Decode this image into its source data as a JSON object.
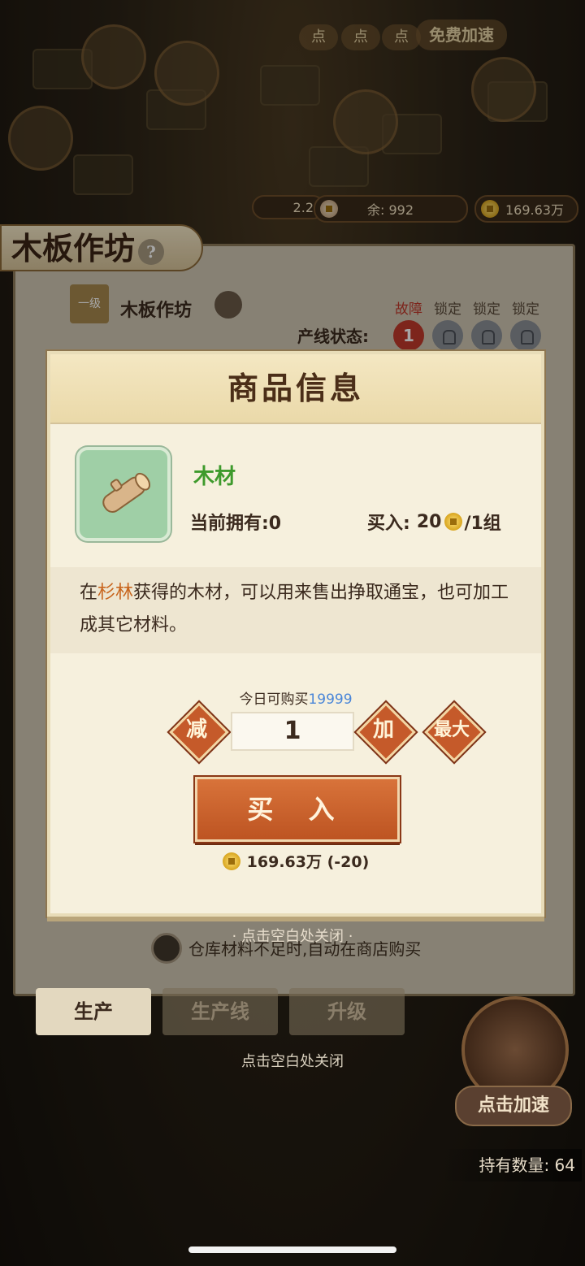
{
  "top_bar": {
    "small_value": "2.2",
    "remaining_label": "余: 992",
    "money": "169.63万"
  },
  "background_labels": {
    "tap_label": "点",
    "free_speedup": "免费加速"
  },
  "workshop": {
    "title": "木板作坊",
    "help": "?",
    "level_tag": "一级",
    "name": "木板作坊",
    "line_status_label": "产线状态:",
    "line_slots": [
      {
        "status": "故障",
        "value": "1"
      },
      {
        "status": "锁定"
      },
      {
        "status": "锁定"
      },
      {
        "status": "锁定"
      }
    ],
    "auto_buy_text": "仓库材料不足时,自动在商店购买",
    "tabs": [
      "生产",
      "生产线",
      "升级"
    ],
    "close_hint": "点击空白处关闭",
    "speed_button": "点击加速",
    "holding": "持有数量: 64"
  },
  "modal": {
    "title": "商品信息",
    "item_name": "木材",
    "owned": "当前拥有:0",
    "buy_label": "买入:",
    "buy_price": "20",
    "per_unit": "/1组",
    "description_prefix": "在",
    "description_highlight": "杉林",
    "description_rest": "获得的木材，可以用来售出挣取通宝，也可加工成其它材料。",
    "daily_label": "今日可购买",
    "daily_value": "19999",
    "decrease": "减",
    "quantity": "1",
    "increase": "加",
    "max": "最大",
    "buy_button": "买 入",
    "cost_summary": "169.63万 (-20)",
    "close_hint": "· 点击空白处关闭 ·"
  },
  "colors": {
    "accent_orange": "#c55a2a",
    "item_green": "#3e9a2c",
    "highlight": "#c8651d",
    "link_blue": "#4a86d8"
  }
}
